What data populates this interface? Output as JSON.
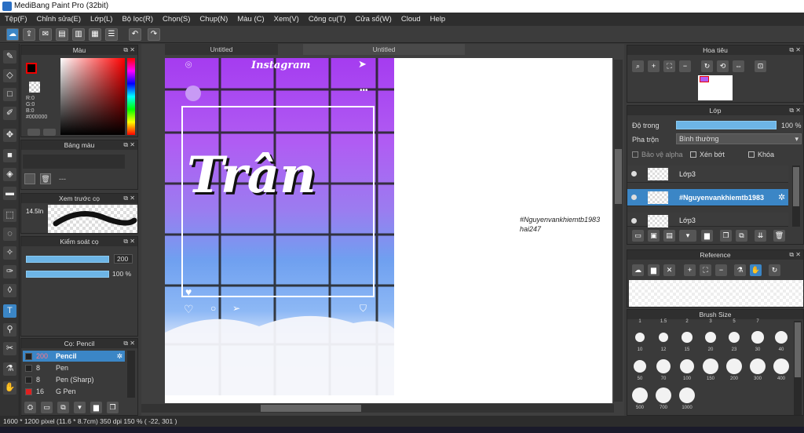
{
  "window": {
    "title": "MediBang Paint Pro (32bit)"
  },
  "menu": [
    "Tệp(F)",
    "Chỉnh sửa(E)",
    "Lớp(L)",
    "Bộ lọc(R)",
    "Chọn(S)",
    "Chụp(N)",
    "Màu (C)",
    "Xem(V)",
    "Công cụ(T)",
    "Cửa sổ(W)",
    "Cloud",
    "Help"
  ],
  "color_panel": {
    "title": "Màu",
    "r": "R:0",
    "g": "G:0",
    "b": "B:0",
    "hex": "#000000"
  },
  "palette_panel": {
    "title": "Bảng màu",
    "placeholder": "---"
  },
  "preview_panel": {
    "title": "Xem trước cọ",
    "size": "14.5In"
  },
  "brush_control": {
    "title": "Kiểm soát cọ",
    "size": "200",
    "opacity": "100 %",
    "size_fill": 1.0,
    "opacity_fill": 1.0
  },
  "brush_panel": {
    "title": "Cọ: Pencil",
    "items": [
      {
        "size": "200",
        "name": "Pencil",
        "color": "#222222"
      },
      {
        "size": "8",
        "name": "Pen",
        "color": "#222222"
      },
      {
        "size": "8",
        "name": "Pen (Sharp)",
        "color": "#222222"
      },
      {
        "size": "16",
        "name": "G Pen",
        "color": "#e02020"
      }
    ]
  },
  "tabs": [
    "Untitled",
    "Untitled"
  ],
  "artwork": {
    "header": "Instagram",
    "name": "Trân",
    "signature_line1": "#Nguyenvankhiemtb1983",
    "signature_line2": "hai247"
  },
  "navigator": {
    "title": "Hoa tiêu"
  },
  "layer_panel": {
    "title": "Lớp",
    "opacity_label": "Độ trong",
    "opacity_value": "100 %",
    "opacity_fill": 1.0,
    "blend_label": "Pha trộn",
    "blend_value": "Bình thường",
    "protect_alpha": "Bảo vệ alpha",
    "clipping": "Xén bớt",
    "lock": "Khóa",
    "layers": [
      {
        "name": "Lớp3"
      },
      {
        "name": "#Nguyenvankhiemtb1983"
      },
      {
        "name": "Lớp3"
      }
    ]
  },
  "reference_panel": {
    "title": "Reference"
  },
  "brush_size_panel": {
    "title": "Brush Size",
    "header_labels": [
      "1",
      "1.5",
      "2",
      "3",
      "5",
      "7"
    ],
    "sizes": [
      "10",
      "12",
      "15",
      "20",
      "23",
      "30",
      "40",
      "50",
      "70",
      "100",
      "150",
      "200",
      "300",
      "400",
      "500",
      "700",
      "1000"
    ]
  },
  "status": {
    "text": "1600 * 1200 pixel   (11.6 * 8.7cm)   350 dpi   150 %   ( -22, 301 )"
  },
  "colors": {
    "accent": "#3b86c6",
    "primary_color": "#000000",
    "hue_red": "#ff0000"
  }
}
